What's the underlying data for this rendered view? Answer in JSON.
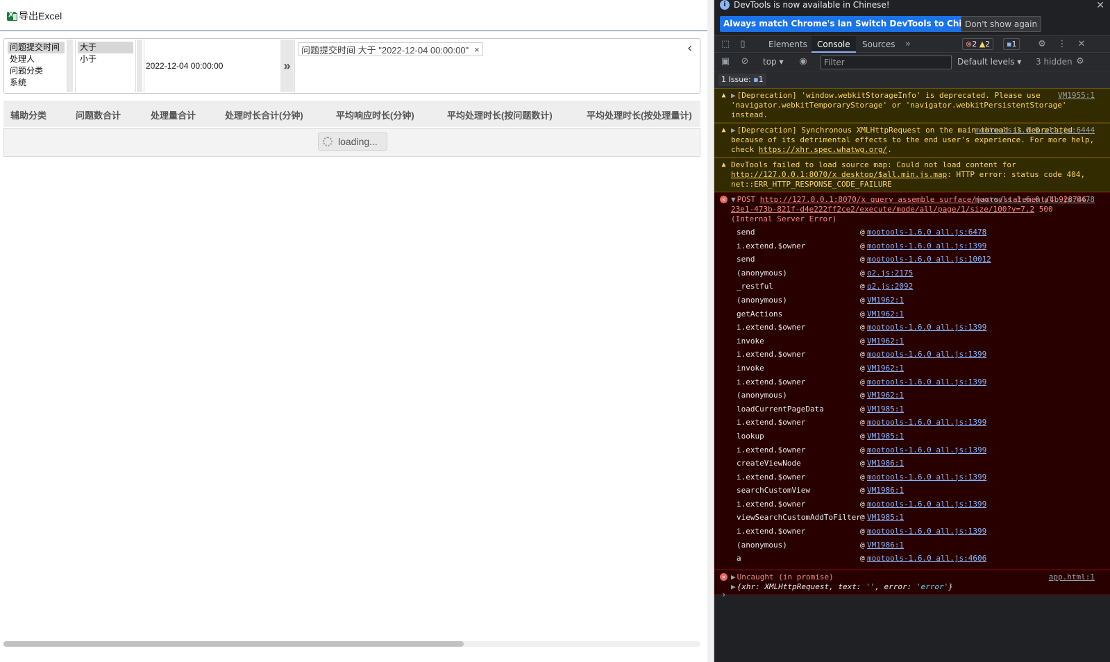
{
  "toolbar": {
    "export_label": "导出Excel"
  },
  "filter": {
    "fields": [
      "问题提交时间",
      "处理人",
      "问题分类",
      "系统"
    ],
    "selected_field_index": 0,
    "operators": [
      "大于",
      "小于"
    ],
    "selected_operator_index": 0,
    "value": "2022-12-04 00:00:00",
    "add_symbol": "»",
    "chips": [
      {
        "text": "问题提交时间  大于  \"2022-12-04 00:00:00\"",
        "remove": "×"
      }
    ],
    "collapse_symbol": "‹"
  },
  "grid": {
    "columns": [
      "辅助分类",
      "问题数合计",
      "处理量合计",
      "处理时长合计(分钟)",
      "平均响应时长(分钟)",
      "平均处理时长(按问题数计)",
      "平均处理时长(按处理量计)"
    ],
    "loading_text": "loading..."
  },
  "devtools": {
    "info": {
      "text": "DevTools is now available in Chinese!",
      "btn_match": "Always match Chrome's language",
      "btn_switch": "Switch DevTools to Chinese",
      "btn_dont": "Don't show again",
      "close": "✕"
    },
    "tabs": [
      "Elements",
      "Console",
      "Sources"
    ],
    "active_tab": "Console",
    "more_tabs": "»",
    "errors": "2",
    "warnings": "2",
    "messages": "1",
    "context": "top ▾",
    "filter_placeholder": "Filter",
    "levels": "Default levels ▾",
    "hidden": "3 hidden",
    "issues": {
      "label": "1 Issue:",
      "count": "1"
    },
    "console": {
      "warn1": {
        "text": "[Deprecation] 'window.webkitStorageInfo' is deprecated. Please use 'navigator.webkitTemporaryStorage' or 'navigator.webkitPersistentStorage' instead.",
        "src": "VM1955:1"
      },
      "warn2": {
        "text_a": "[Deprecation] Synchronous XMLHttpRequest on the main thread is deprecated because of its detrimental effects to the end user's experience. For more help, check ",
        "link": "https://xhr.spec.whatwg.org/",
        "text_b": ".",
        "src": "mootools-1.6.0 all.js:6444"
      },
      "warn3": {
        "text_a": "DevTools failed to load source map: Could not load content for ",
        "link": "http://127.0.0.1:8070/x desktop/$all.min.js.map",
        "text_b": ": HTTP error: status code 404, net::ERR_HTTP_RESPONSE_CODE_FAILURE"
      },
      "err1": {
        "method": "POST",
        "url": "http://127.0.0.1:8070/x query assemble surface/jaxrs/statement/4b928746-23e1-473b-821f-d4e222ff2ce2/execute/mode/all/page/1/size/100?v=7.2",
        "status": "500 (Internal Server Error)",
        "src": "mootools-1.6.0 all.js:6478",
        "stack": [
          {
            "fn": "send",
            "loc": "mootools-1.6.0 all.js:6478"
          },
          {
            "fn": "i.extend.$owner",
            "loc": "mootools-1.6.0 all.js:1399"
          },
          {
            "fn": "send",
            "loc": "mootools-1.6.0 all.js:10012"
          },
          {
            "fn": "(anonymous)",
            "loc": "o2.js:2175"
          },
          {
            "fn": "_restful",
            "loc": "o2.js:2092"
          },
          {
            "fn": "(anonymous)",
            "loc": "VM1962:1"
          },
          {
            "fn": "getActions",
            "loc": "VM1962:1"
          },
          {
            "fn": "i.extend.$owner",
            "loc": "mootools-1.6.0 all.js:1399"
          },
          {
            "fn": "invoke",
            "loc": "VM1962:1"
          },
          {
            "fn": "i.extend.$owner",
            "loc": "mootools-1.6.0 all.js:1399"
          },
          {
            "fn": "invoke",
            "loc": "VM1962:1"
          },
          {
            "fn": "i.extend.$owner",
            "loc": "mootools-1.6.0 all.js:1399"
          },
          {
            "fn": "(anonymous)",
            "loc": "VM1962:1"
          },
          {
            "fn": "loadCurrentPageData",
            "loc": "VM1985:1"
          },
          {
            "fn": "i.extend.$owner",
            "loc": "mootools-1.6.0 all.js:1399"
          },
          {
            "fn": "lookup",
            "loc": "VM1985:1"
          },
          {
            "fn": "i.extend.$owner",
            "loc": "mootools-1.6.0 all.js:1399"
          },
          {
            "fn": "createViewNode",
            "loc": "VM1986:1"
          },
          {
            "fn": "i.extend.$owner",
            "loc": "mootools-1.6.0 all.js:1399"
          },
          {
            "fn": "searchCustomView",
            "loc": "VM1986:1"
          },
          {
            "fn": "i.extend.$owner",
            "loc": "mootools-1.6.0 all.js:1399"
          },
          {
            "fn": "viewSearchCustomAddToFilter",
            "loc": "VM1985:1"
          },
          {
            "fn": "i.extend.$owner",
            "loc": "mootools-1.6.0 all.js:1399"
          },
          {
            "fn": "(anonymous)",
            "loc": "VM1986:1"
          },
          {
            "fn": "a",
            "loc": "mootools-1.6.0 all.js:4606"
          }
        ]
      },
      "err2": {
        "text": "Uncaught (in promise)",
        "src": "app.html:1",
        "obj_a": "{xhr: XMLHttpRequest, text: ",
        "obj_s1": "''",
        "obj_b": ", error: ",
        "obj_s2": "'error'",
        "obj_c": "}"
      }
    },
    "prompt": "›"
  }
}
